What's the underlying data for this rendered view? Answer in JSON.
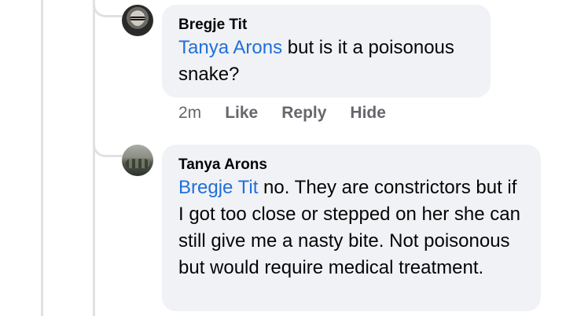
{
  "comments": [
    {
      "author": "Bregje Tit",
      "mention": "Tanya Arons",
      "text": " but is it a poisonous snake?",
      "time": "2m",
      "actions": [
        "Like",
        "Reply",
        "Hide"
      ]
    },
    {
      "author": "Tanya Arons",
      "mention": "Bregje Tit",
      "text": " no.  They are constrictors but if I got too close or stepped on her she can still give me a nasty bite.  Not poisonous but would require medical treatment."
    }
  ],
  "icons": {
    "avatar_1": "person-with-glasses-avatar",
    "avatar_2": "snake-photo-avatar"
  },
  "colors": {
    "bubble": "#f0f2f5",
    "mention": "#216fdb",
    "meta": "#65676b",
    "thread_line": "#dfe1e4"
  }
}
